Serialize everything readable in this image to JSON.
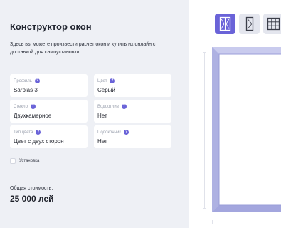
{
  "header": {
    "title": "Конструктор окон",
    "description": "Здесь вы можете произвести расчет окон и купить их онлайн с доставкой для самоустановки"
  },
  "fields": {
    "profile": {
      "label": "Профиль",
      "value": "Sarplas 3"
    },
    "color": {
      "label": "Цвет",
      "value": "Серый"
    },
    "glass": {
      "label": "Стекло",
      "value": "Двухкамерное"
    },
    "drain": {
      "label": "Водоотлив",
      "value": "Нет"
    },
    "color_type": {
      "label": "Тип цвета",
      "value": "Цвет с двух сторон"
    },
    "sill": {
      "label": "Подоконник",
      "value": "Нет"
    }
  },
  "help_glyph": "?",
  "installation": {
    "label": "Установка",
    "checked": false
  },
  "total": {
    "label": "Общая стоимость:",
    "value": "25 000 лей"
  },
  "window_types": [
    {
      "icon": "window-double-icon",
      "active": true
    },
    {
      "icon": "window-single-icon",
      "active": false
    },
    {
      "icon": "window-grid-icon",
      "active": false
    }
  ],
  "colors": {
    "accent": "#6a63d8",
    "panel_bg": "#eef0f5",
    "frame": "#b7b9e6"
  }
}
